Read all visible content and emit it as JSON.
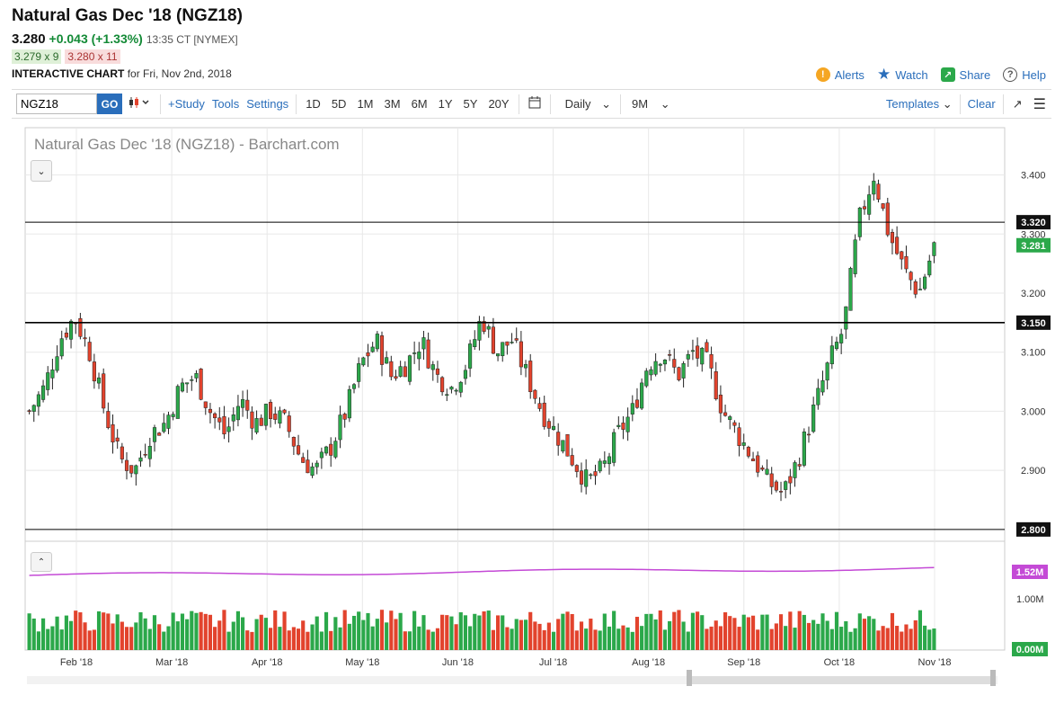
{
  "header": {
    "title": "Natural Gas Dec '18 (NGZ18)",
    "last": "3.280",
    "change": "+0.043 (+1.33%)",
    "time": "13:35 CT [NYMEX]",
    "bid": "3.279 x 9",
    "ask": "3.280 x 11",
    "chart_label": "INTERACTIVE CHART",
    "chart_date": "for Fri, Nov 2nd, 2018"
  },
  "actions": {
    "alerts": "Alerts",
    "watch": "Watch",
    "share": "Share",
    "help": "Help"
  },
  "toolbar": {
    "symbol": "NGZ18",
    "go": "GO",
    "study": "+Study",
    "tools": "Tools",
    "settings": "Settings",
    "ranges": [
      "1D",
      "5D",
      "1M",
      "3M",
      "6M",
      "1Y",
      "5Y",
      "20Y"
    ],
    "interval": "Daily",
    "period": "9M",
    "templates": "Templates",
    "clear": "Clear"
  },
  "chart_data": {
    "type": "candlestick",
    "title": "Natural Gas Dec '18 (NGZ18) - Barchart.com",
    "ylim": [
      2.78,
      3.48
    ],
    "y_ticks": [
      "3.400",
      "3.300",
      "3.200",
      "3.100",
      "3.000",
      "2.900"
    ],
    "x_ticks": [
      "Feb '18",
      "Mar '18",
      "Apr '18",
      "May '18",
      "Jun '18",
      "Jul '18",
      "Aug '18",
      "Sep '18",
      "Oct '18",
      "Nov '18"
    ],
    "horizontal_lines": [
      {
        "value": 3.32,
        "label": "3.320"
      },
      {
        "value": 3.15,
        "label": "3.150"
      },
      {
        "value": 2.8,
        "label": "2.800"
      }
    ],
    "last_price_label": "3.281",
    "last_price": 3.281,
    "close_path": [
      3.0,
      3.04,
      3.12,
      3.16,
      3.1,
      3.0,
      2.92,
      2.9,
      2.96,
      2.98,
      3.04,
      3.06,
      3.0,
      2.96,
      3.02,
      2.98,
      3.0,
      2.98,
      2.92,
      2.9,
      2.94,
      3.0,
      3.08,
      3.12,
      3.06,
      3.08,
      3.12,
      3.06,
      3.04,
      3.08,
      3.16,
      3.1,
      3.12,
      3.06,
      3.0,
      2.96,
      2.92,
      2.88,
      2.9,
      2.96,
      3.0,
      3.08,
      3.1,
      3.06,
      3.1,
      3.08,
      3.0,
      2.96,
      2.92,
      2.88,
      2.86,
      2.92,
      3.0,
      3.08,
      3.14,
      3.32,
      3.4,
      3.3,
      3.24,
      3.2,
      3.28
    ],
    "volume": {
      "labels": [
        "1.52M",
        "1.00M",
        "0.00M"
      ],
      "last": "1.52M"
    }
  },
  "colors": {
    "up": "#2ba84a",
    "down": "#e2432d",
    "ma": "#c44ad6",
    "accent": "#2a6ebb"
  }
}
